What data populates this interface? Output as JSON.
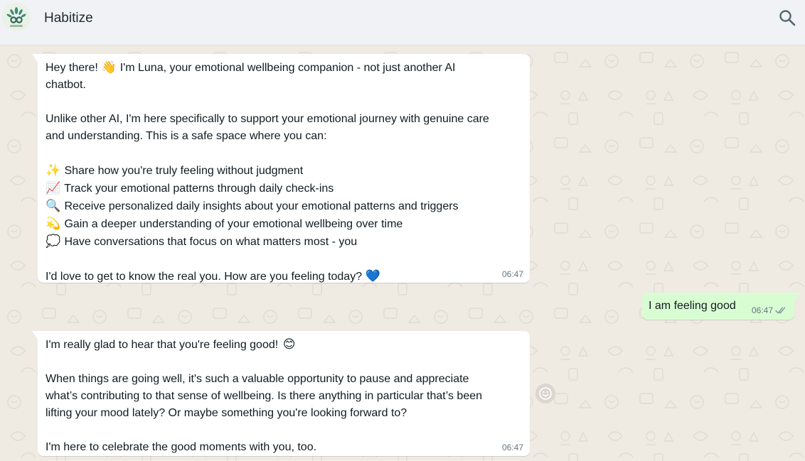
{
  "header": {
    "title": "Habitize",
    "avatar_text": "Habitize",
    "search_icon": "search-icon"
  },
  "colors": {
    "header_bg": "#f0f2f5",
    "chat_bg": "#efeae2",
    "incoming_bubble": "#ffffff",
    "outgoing_bubble": "#d9fdd3",
    "timestamp": "#667781",
    "read_ticks": "#8696a0"
  },
  "messages": [
    {
      "direction": "incoming",
      "time": "06:47",
      "intro_emoji": "👋",
      "intro_line1": "Hey there!",
      "intro_line1_rest": "I'm Luna, your emotional wellbeing companion - not just another AI",
      "intro_line2": "chatbot.",
      "para2_line1": "Unlike other AI, I'm here specifically to support your emotional journey with genuine care",
      "para2_line2": "and understanding. This is a safe space where you can:",
      "bullets": [
        {
          "icon": "sparkles-icon",
          "glyph": "✨",
          "text": "Share how you're truly feeling without judgment"
        },
        {
          "icon": "chart-increasing-icon",
          "glyph": "📈",
          "text": "Track your emotional patterns through daily check-ins"
        },
        {
          "icon": "magnifier-icon",
          "glyph": "🔍",
          "text": "Receive personalized daily insights about your emotional patterns and triggers"
        },
        {
          "icon": "dizzy-icon",
          "glyph": "💫",
          "text": "Gain a deeper understanding of your emotional wellbeing over time"
        },
        {
          "icon": "speech-balloon-icon",
          "glyph": "💭",
          "text": "Have conversations that focus on what matters most - you"
        }
      ],
      "closing": "I'd love to get to know the real you. How are you feeling today?",
      "closing_emoji": "💙"
    },
    {
      "direction": "outgoing",
      "time": "06:47",
      "text": "I am feeling good",
      "status": "read"
    },
    {
      "direction": "incoming",
      "time": "06:47",
      "line1": "I'm really glad to hear that you're feeling good!",
      "line1_emoji": "😊",
      "para2_line1": "When things are going well, it's such a valuable opportunity to pause and appreciate",
      "para2_line2": "what’s contributing to that sense of wellbeing. Is there anything in particular that’s been",
      "para2_line3": "lifting your mood lately? Or maybe something you're looking forward to?",
      "closing": "I'm here to celebrate the good moments with you, too."
    }
  ],
  "reaction_button_icon": "smiley-icon"
}
